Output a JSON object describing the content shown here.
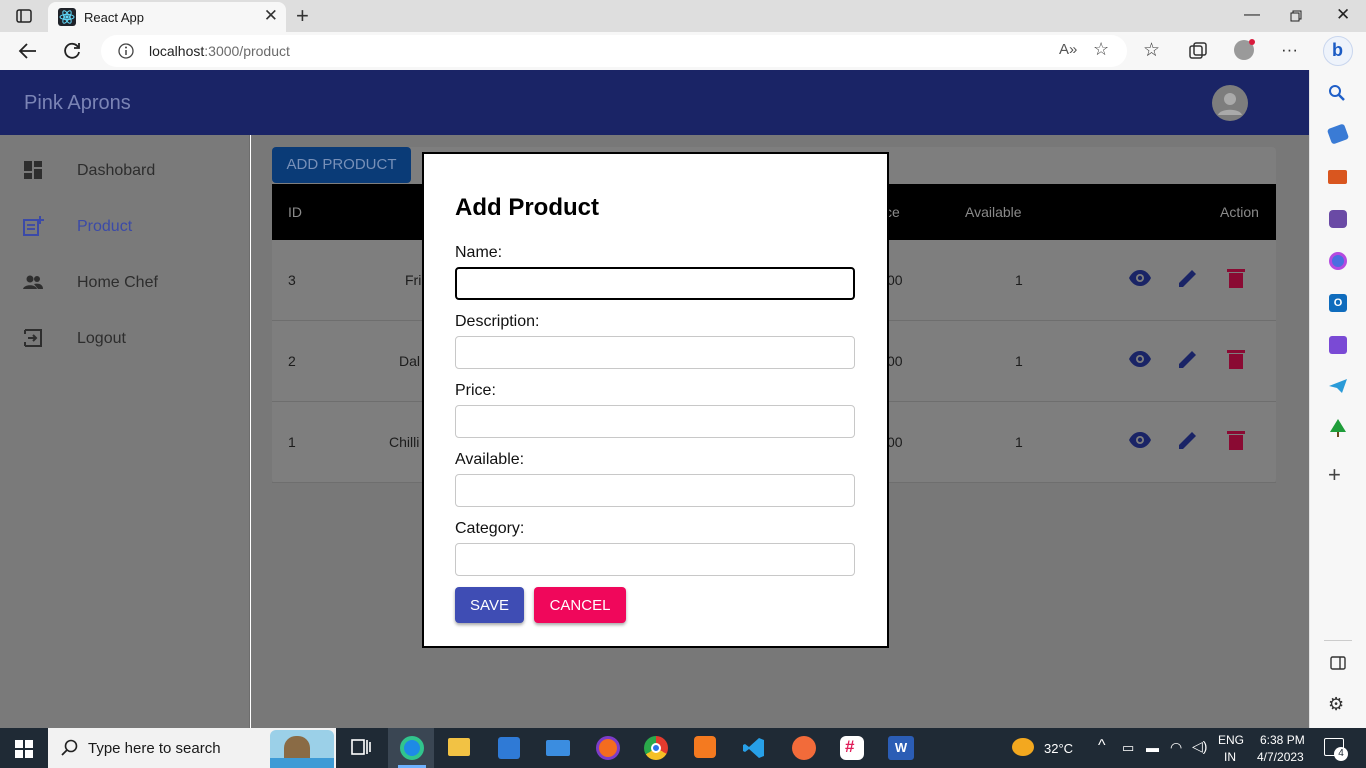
{
  "browser": {
    "tab_title": "React App",
    "url_host": "localhost",
    "url_path": ":3000/product"
  },
  "app": {
    "brand": "Pink Aprons",
    "nav": [
      {
        "label": "Dashobard",
        "icon": "dashboard-icon"
      },
      {
        "label": "Product",
        "icon": "post-add-icon",
        "active": true
      },
      {
        "label": "Home Chef",
        "icon": "people-icon"
      },
      {
        "label": "Logout",
        "icon": "logout-icon"
      }
    ],
    "add_product_label": "ADD PRODUCT",
    "table": {
      "headers": {
        "id": "ID",
        "price_partial": "ce",
        "available": "Available",
        "action": "Action"
      },
      "rows": [
        {
          "id": "3",
          "name_partial": "Fri",
          "price_partial": "00",
          "available": "1"
        },
        {
          "id": "2",
          "name_partial": "Dal",
          "price_partial": "00",
          "available": "1"
        },
        {
          "id": "1",
          "name_partial": "Chilli",
          "price_partial": "00",
          "available": "1"
        }
      ]
    }
  },
  "modal": {
    "title": "Add Product",
    "fields": [
      {
        "label": "Name:",
        "value": ""
      },
      {
        "label": "Description:",
        "value": ""
      },
      {
        "label": "Price:",
        "value": ""
      },
      {
        "label": "Available:",
        "value": ""
      },
      {
        "label": "Category:",
        "value": ""
      }
    ],
    "save_label": "SAVE",
    "cancel_label": "CANCEL"
  },
  "taskbar": {
    "search_placeholder": "Type here to search",
    "temperature": "32°C",
    "lang_1": "ENG",
    "lang_2": "IN",
    "time": "6:38 PM",
    "date": "4/7/2023",
    "notification_count": "4"
  },
  "colors": {
    "appbar": "#1a2466",
    "save": "#3f4db4",
    "cancel": "#f0075b",
    "nav_active": "#3b4aa8"
  }
}
